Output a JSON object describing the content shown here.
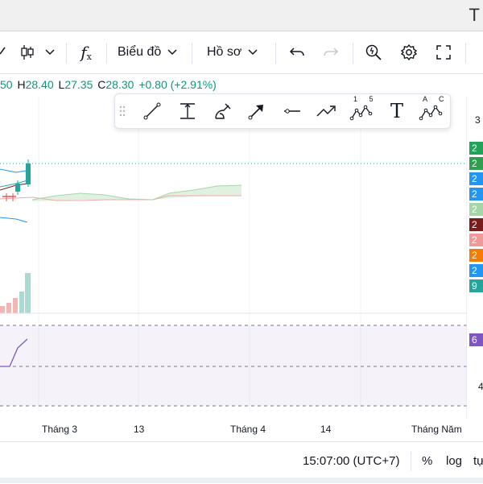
{
  "toolbar": {
    "chart_menu_label": "Biểu đồ",
    "profile_menu_label": "Hồ sơ",
    "window_title_fragment": "T"
  },
  "ohlc": {
    "open_value": "50",
    "high_label": "H",
    "high_value": "28.40",
    "low_label": "L",
    "low_value": "27.35",
    "close_label": "C",
    "close_value": "28.30",
    "change": "+0.80 (+2.91%)"
  },
  "drawing_tools": {
    "fib_label": "1 5",
    "abc_label": "A C",
    "text_tool_glyph": "T"
  },
  "price_axis": {
    "top_tick": "3",
    "tags": [
      {
        "text": "2",
        "color": "#22a35a"
      },
      {
        "text": "2",
        "color": "#2e9e4f"
      },
      {
        "text": "2",
        "color": "#2196f3"
      },
      {
        "text": "2",
        "color": "#2196f3"
      },
      {
        "text": "2",
        "color": "#a5d6a7"
      },
      {
        "text": "2",
        "color": "#7b1c1c"
      },
      {
        "text": "2",
        "color": "#ef9a9a"
      },
      {
        "text": "2",
        "color": "#f57c00"
      },
      {
        "text": "2",
        "color": "#2196f3"
      },
      {
        "text": "9",
        "color": "#26a69a"
      }
    ],
    "rsi_tag": {
      "text": "6",
      "color": "#7e57c2"
    },
    "rsi_tick": "4"
  },
  "time_axis": {
    "labels": [
      "Tháng 3",
      "13",
      "Tháng 4",
      "14",
      "Tháng Năm"
    ]
  },
  "statusbar": {
    "time": "15:07:00 (UTC+7)",
    "percent": "%",
    "log": "log",
    "auto": "tự"
  },
  "colors": {
    "up": "#26a69a",
    "down": "#ef5350",
    "rsi": "#7e57c2",
    "accent": "#2962ff"
  }
}
